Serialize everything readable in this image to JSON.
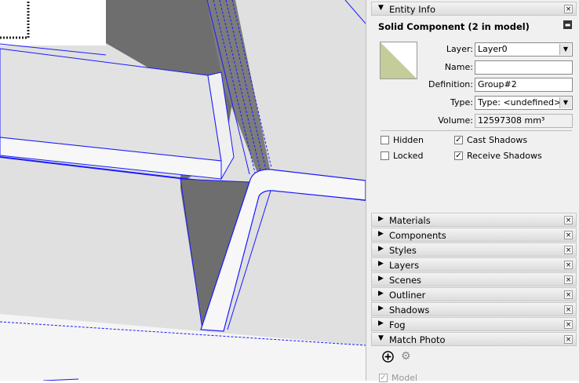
{
  "entity_info": {
    "title": "Entity Info",
    "component_title": "Solid Component (2 in model)",
    "layer_label": "Layer:",
    "layer_value": "Layer0",
    "name_label": "Name:",
    "name_value": "",
    "definition_label": "Definition:",
    "definition_value": "Group#2",
    "type_label": "Type:",
    "type_value": "Type: <undefined>",
    "volume_label": "Volume:",
    "volume_value": "12597308 mm³",
    "hidden_label": "Hidden",
    "hidden_checked": false,
    "cast_shadows_label": "Cast Shadows",
    "cast_shadows_checked": true,
    "locked_label": "Locked",
    "locked_checked": false,
    "receive_shadows_label": "Receive Shadows",
    "receive_shadows_checked": true,
    "swatch_color": "#c4cc9a"
  },
  "panels": [
    {
      "label": "Materials"
    },
    {
      "label": "Components"
    },
    {
      "label": "Styles"
    },
    {
      "label": "Layers"
    },
    {
      "label": "Scenes"
    },
    {
      "label": "Outliner"
    },
    {
      "label": "Shadows"
    },
    {
      "label": "Fog"
    },
    {
      "label": "Match Photo"
    }
  ],
  "match_photo": {
    "add_icon": "add-circle-icon",
    "settings_icon": "gear-icon",
    "model_label": "Model"
  },
  "icons": {
    "expand": "▼",
    "collapse": "▶",
    "close": "×",
    "check": "✓",
    "minimize": "▬"
  },
  "colors": {
    "edge_blue": "#0000ff",
    "face_gray": "#e0e0e0",
    "shadow_gray": "#6e6e6e"
  }
}
